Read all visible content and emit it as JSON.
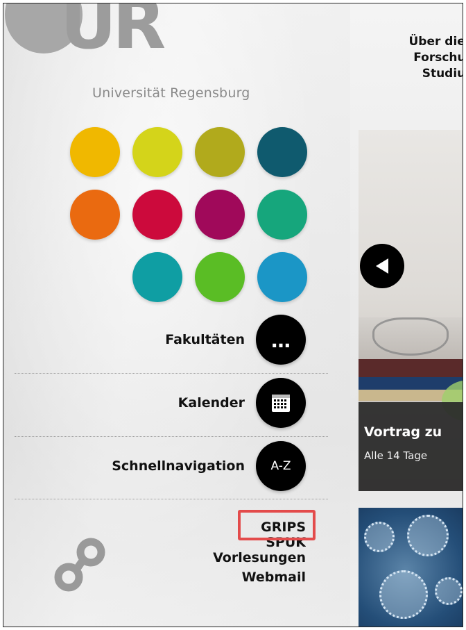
{
  "logo": {
    "letters": "UR",
    "subtitle": "Universität Regensburg"
  },
  "topnav": {
    "items": [
      "Über die U",
      "Forschun",
      "Studiu"
    ]
  },
  "faculty_dots": {
    "colors": [
      "#f0b800",
      "#d4d41a",
      "#b1aa1c",
      "#0f5a6e",
      "#ea6a10",
      "#cc0a3c",
      "#a0095a",
      "#16a67c",
      "#0f9ea3",
      "#5abd25",
      "#1b96c6"
    ]
  },
  "links": {
    "fakultaeten": {
      "label": "Fakultäten",
      "icon": "ellipsis-icon",
      "glyph": "…"
    },
    "kalender": {
      "label": "Kalender",
      "icon": "calendar-icon"
    },
    "schnellnavigation": {
      "label": "Schnellnavigation",
      "icon": "a-z-icon",
      "glyph": "A-Z"
    }
  },
  "quicklinks": [
    "GRIPS",
    "SPUK",
    "Vorlesungen",
    "Webmail"
  ],
  "news": {
    "card1": {
      "title": "Vortrag zu",
      "subtitle": "Alle 14 Tage"
    }
  }
}
